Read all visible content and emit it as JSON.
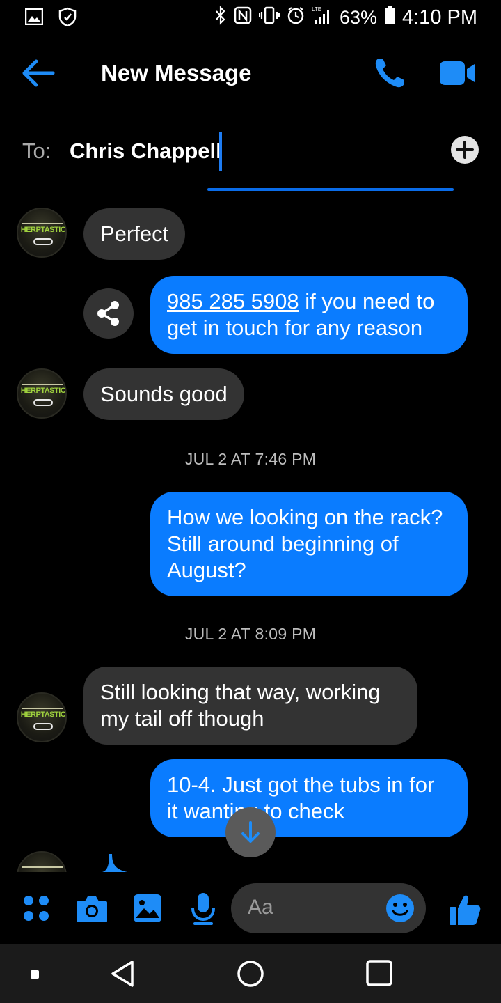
{
  "status_bar": {
    "battery_percent": "63%",
    "time": "4:10 PM",
    "network": "LTE",
    "icons": [
      "image-icon",
      "shield-icon",
      "bluetooth-icon",
      "nfc-icon",
      "vibrate-icon",
      "alarm-icon",
      "signal-icon",
      "battery-icon"
    ]
  },
  "header": {
    "title": "New Message",
    "icons": [
      "back-arrow-icon",
      "phone-icon",
      "video-camera-icon"
    ]
  },
  "to_field": {
    "label": "To:",
    "value": "Chris Chappell"
  },
  "messages": [
    {
      "direction": "in",
      "text": "Perfect"
    },
    {
      "direction": "out",
      "link": "985 285 5908",
      "text": " if you need to get in touch for any reason"
    },
    {
      "direction": "in",
      "text": "Sounds good"
    },
    {
      "type": "timestamp",
      "text": "JUL 2 AT 7:46 PM"
    },
    {
      "direction": "out",
      "text": "How we looking on the rack? Still around beginning of August?"
    },
    {
      "type": "timestamp",
      "text": "JUL 2 AT 8:09 PM"
    },
    {
      "direction": "in",
      "text": "Still looking that way, working my tail off though"
    },
    {
      "direction": "out",
      "text": "10-4. Just got the tubs in for it wanting to check"
    }
  ],
  "avatar_text": "HERPTASTIC",
  "composer": {
    "placeholder": "Aa",
    "tools": [
      "menu-dots-icon",
      "camera-icon",
      "gallery-icon",
      "microphone-icon",
      "emoji-icon",
      "thumbs-up-icon"
    ]
  },
  "colors": {
    "accent": "#0a7cff",
    "incoming_bubble": "#333333",
    "background": "#000000"
  }
}
